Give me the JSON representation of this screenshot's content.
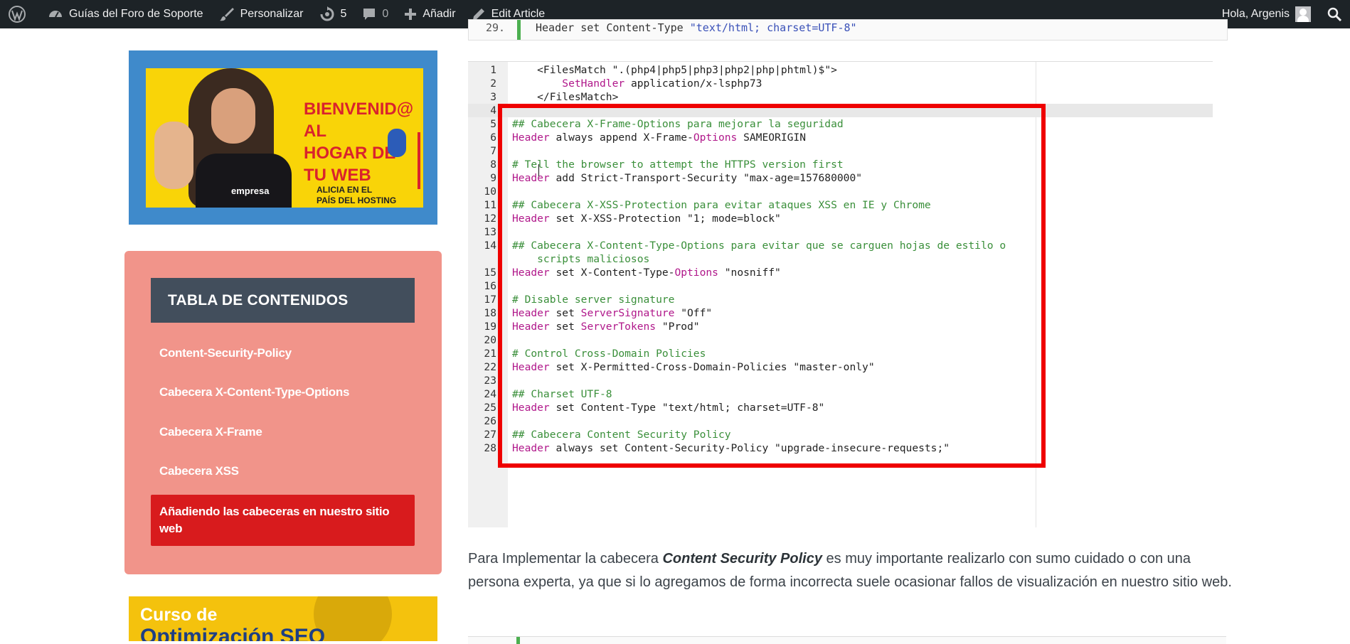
{
  "admin_bar": {
    "site_name": "Guías del Foro de Soporte",
    "customize": "Personalizar",
    "updates_count": "5",
    "comments_count": "0",
    "new": "Añadir",
    "edit": "Edit Article",
    "greeting": "Hola, Argenis",
    "icons": [
      "wordpress-icon",
      "dashboard-icon",
      "brush-icon",
      "updates-icon",
      "comment-icon",
      "plus-icon",
      "pencil-icon",
      "avatar",
      "search-icon"
    ]
  },
  "banner1": {
    "title": "BIENVENID@ AL\nHOGAR DE\nTU WEB",
    "subtitle": "ALICIA EN EL\nPAÍS DEL HOSTING",
    "shirt_text": "empresa"
  },
  "toc": {
    "title": "TABLA DE CONTENIDOS",
    "items": [
      {
        "label": "Content-Security-Policy"
      },
      {
        "label": "Cabecera X-Content-Type-Options"
      },
      {
        "label": "Cabecera X-Frame"
      },
      {
        "label": "Cabecera XSS"
      },
      {
        "label": "Añadiendo las cabeceras en nuestro sitio web",
        "active": true
      }
    ]
  },
  "banner2": {
    "line1": "Curso de",
    "line2": "Optimización SEO"
  },
  "code_top": {
    "line_number": "29.",
    "code_a": "Header set Content-Type ",
    "code_b": "\"text/html; charset=UTF-8\""
  },
  "editor": {
    "lines": [
      {
        "n": "1",
        "parts": [
          [
            "tg",
            "    <FilesMatch "
          ],
          [
            "str",
            "\".(php4|php5|php3|php2|php|phtml)$\""
          ],
          [
            "tg",
            ">"
          ]
        ]
      },
      {
        "n": "2",
        "parts": [
          [
            "tg",
            "        "
          ],
          [
            "kw",
            "SetHandler"
          ],
          [
            "tg",
            " application/x-lsphp73"
          ]
        ]
      },
      {
        "n": "3",
        "parts": [
          [
            "tg",
            "    </FilesMatch>"
          ]
        ]
      },
      {
        "n": "4",
        "parts": [],
        "current": true
      },
      {
        "n": "5",
        "parts": [
          [
            "cm",
            "## Cabecera X-Frame-Options para mejorar la seguridad"
          ]
        ]
      },
      {
        "n": "6",
        "parts": [
          [
            "kw",
            "Header"
          ],
          [
            "tg",
            " always append X-Frame-"
          ],
          [
            "kw",
            "Options"
          ],
          [
            "tg",
            " SAMEORIGIN"
          ]
        ]
      },
      {
        "n": "7",
        "parts": []
      },
      {
        "n": "8",
        "parts": [
          [
            "cm",
            "# Tell the browser to attempt the HTTPS version first"
          ]
        ]
      },
      {
        "n": "9",
        "parts": [
          [
            "kw",
            "Header"
          ],
          [
            "tg",
            " add Strict-Transport-Security \"max-age=157680000\""
          ]
        ]
      },
      {
        "n": "10",
        "parts": []
      },
      {
        "n": "11",
        "parts": [
          [
            "cm",
            "## Cabecera X-XSS-Protection para evitar ataques XSS en IE y Chrome"
          ]
        ]
      },
      {
        "n": "12",
        "parts": [
          [
            "kw",
            "Header"
          ],
          [
            "tg",
            " set X-XSS-Protection \"1; mode=block\""
          ]
        ]
      },
      {
        "n": "13",
        "parts": []
      },
      {
        "n": "14",
        "parts": [
          [
            "cm",
            "## Cabecera X-Content-Type-Options para evitar que se carguen hojas de estilo o"
          ]
        ]
      },
      {
        "n": "",
        "parts": [
          [
            "cm",
            "    scripts maliciosos"
          ]
        ]
      },
      {
        "n": "15",
        "parts": [
          [
            "kw",
            "Header"
          ],
          [
            "tg",
            " set X-Content-Type-"
          ],
          [
            "kw",
            "Options"
          ],
          [
            "tg",
            " \"nosniff\""
          ]
        ]
      },
      {
        "n": "16",
        "parts": []
      },
      {
        "n": "17",
        "parts": [
          [
            "cm",
            "# Disable server signature"
          ]
        ]
      },
      {
        "n": "18",
        "parts": [
          [
            "kw",
            "Header"
          ],
          [
            "tg",
            " set "
          ],
          [
            "kw",
            "ServerSignature"
          ],
          [
            "tg",
            " \"Off\""
          ]
        ]
      },
      {
        "n": "19",
        "parts": [
          [
            "kw",
            "Header"
          ],
          [
            "tg",
            " set "
          ],
          [
            "kw",
            "ServerTokens"
          ],
          [
            "tg",
            " \"Prod\""
          ]
        ]
      },
      {
        "n": "20",
        "parts": []
      },
      {
        "n": "21",
        "parts": [
          [
            "cm",
            "# Control Cross-Domain Policies"
          ]
        ]
      },
      {
        "n": "22",
        "parts": [
          [
            "kw",
            "Header"
          ],
          [
            "tg",
            " set X-Permitted-Cross-Domain-Policies \"master-only\""
          ]
        ]
      },
      {
        "n": "23",
        "parts": []
      },
      {
        "n": "24",
        "parts": [
          [
            "cm",
            "## Charset UTF-8"
          ]
        ]
      },
      {
        "n": "25",
        "parts": [
          [
            "kw",
            "Header"
          ],
          [
            "tg",
            " set Content-Type \"text/html; charset=UTF-8\""
          ]
        ]
      },
      {
        "n": "26",
        "parts": []
      },
      {
        "n": "27",
        "parts": [
          [
            "cm",
            "## Cabecera Content Security Policy"
          ]
        ]
      },
      {
        "n": "28",
        "parts": [
          [
            "kw",
            "Header"
          ],
          [
            "tg",
            " always set Content-Security-Policy \"upgrade-insecure-requests;\""
          ]
        ]
      }
    ]
  },
  "paragraph": {
    "before": "Para Implementar la cabecera ",
    "emphasis": "Content Security Policy",
    "after": " es muy importante realizarlo con sumo cuidado o con una persona experta, ya que si lo agregamos de forma incorrecta suele ocasionar fallos de visualización en nuestro sitio web."
  },
  "colors": {
    "admin_bar": "#1d2327",
    "toc_bg": "#f1948a",
    "toc_header": "#424e5c",
    "toc_active": "#d81b1d",
    "highlight": "#ef0000"
  }
}
